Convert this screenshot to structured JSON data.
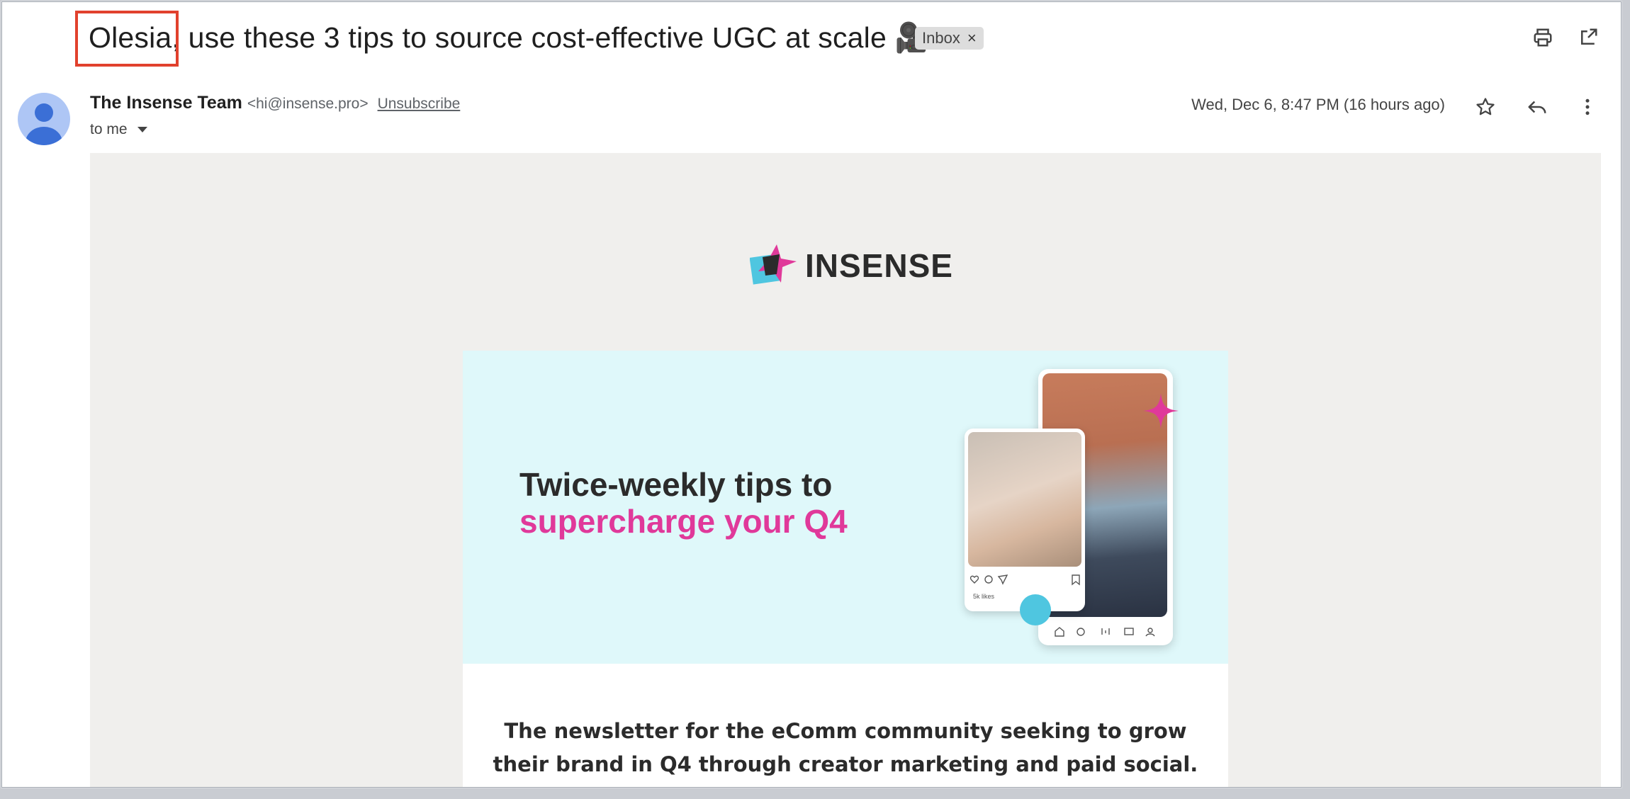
{
  "email": {
    "subject_name": "Olesia,",
    "subject_rest": " use these 3 tips to source cost-effective UGC at scale",
    "subject_emoji": "🎥",
    "label_chip": "Inbox",
    "chip_close": "×",
    "sender_name": "The Insense Team",
    "sender_email": "<hi@insense.pro>",
    "unsubscribe": "Unsubscribe",
    "to": "to me",
    "date": "Wed, Dec 6, 8:47 PM (16 hours ago)"
  },
  "newsletter": {
    "brand": "INSENSE",
    "hero_line1": "Twice-weekly tips to",
    "hero_line2": "supercharge your Q4",
    "hero_likes": "5k likes",
    "intro_line1": "The newsletter for the eComm community seeking to grow",
    "intro_line2": "their brand in Q4 through creator marketing and paid social."
  },
  "colors": {
    "highlight": "#e1412d",
    "hero_accent": "#e0399a",
    "hero_bg": "#dff8fa"
  }
}
